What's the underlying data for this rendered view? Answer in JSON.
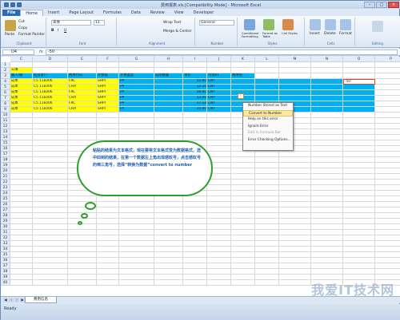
{
  "window": {
    "title": "费用报表.xls [Compatibility Mode] - Microsoft Excel"
  },
  "ribbon_tabs": [
    "File",
    "Home",
    "Insert",
    "Page Layout",
    "Formulas",
    "Data",
    "Review",
    "View",
    "Developer"
  ],
  "ribbon": {
    "clipboard": {
      "cut": "Cut",
      "copy": "Copy",
      "format_painter": "Format Painter",
      "paste": "Paste",
      "label": "Clipboard"
    },
    "font": {
      "name": "宋体",
      "size": "11",
      "label": "Font"
    },
    "alignment": {
      "wrap": "Wrap Text",
      "merge": "Merge & Center",
      "label": "Alignment"
    },
    "number": {
      "format": "General",
      "label": "Number"
    },
    "styles": {
      "conditional": "Conditional Formatting",
      "format_table": "Format as Table",
      "cell_styles": "Cell Styles",
      "label": "Styles"
    },
    "cells": {
      "insert": "Insert",
      "delete": "Delete",
      "format": "Format",
      "label": "Cells"
    },
    "editing": {
      "label": "Editing"
    }
  },
  "formula_bar": {
    "name_box": "O4",
    "fx": "fx",
    "value": "-50"
  },
  "columns": [
    "C",
    "D",
    "E",
    "F",
    "G",
    "H",
    "I",
    "J",
    "K",
    "L",
    "M",
    "N",
    "O",
    "P"
  ],
  "rows": [
    "1",
    "2",
    "3",
    "4",
    "5",
    "6",
    "7",
    "8",
    "9",
    "10",
    "11",
    "12",
    "13",
    "14",
    "15",
    "16",
    "17",
    "18",
    "19",
    "20",
    "21",
    "22",
    "23",
    "24",
    "25",
    "26",
    "27",
    "28",
    "29",
    "30",
    "31",
    "32",
    "33",
    "34",
    "35",
    "36",
    "37",
    "38",
    "39",
    "40"
  ],
  "sheet": {
    "title_cell": "公填",
    "headers": [
      "输入/输",
      "提货客户",
      "费用代码",
      "计费规",
      "计费类型",
      "实际数量",
      "单价",
      "币别01",
      "费用组"
    ],
    "data_rows": [
      [
        "成本",
        "C5 11E006",
        "FRC",
        "SHPT",
        "PP",
        "",
        "55.00",
        "CNY",
        ""
      ],
      [
        "成本",
        "C5 11E006",
        "CHA",
        "SHPT",
        "PP",
        "",
        "12.35",
        "CNY",
        ""
      ],
      [
        "成本",
        "C5 11E006",
        "FRC",
        "SHPT",
        "PP",
        "",
        "58.00",
        "CNY",
        ""
      ],
      [
        "成本",
        "C5 11E006",
        "CHA",
        "SHPT",
        "PP",
        "",
        "13.00",
        "CNY",
        ""
      ],
      [
        "成本",
        "C5 11E006",
        "FRC",
        "SHPT",
        "PP",
        "",
        "27.14",
        "CNY",
        ""
      ],
      [
        "成本",
        "C5 11E006",
        "CHA",
        "SHPT",
        "PP",
        "",
        "35.00",
        "CNY",
        ""
      ]
    ],
    "selected_value": "-50"
  },
  "context_menu": {
    "items": [
      {
        "label": "Number Stored as Text",
        "disabled": false,
        "highlight": false
      },
      {
        "label": "Convert to Number",
        "disabled": false,
        "highlight": true
      },
      {
        "label": "Help on this error",
        "disabled": false,
        "highlight": false
      },
      {
        "label": "Ignore Error",
        "disabled": false,
        "highlight": false
      },
      {
        "label": "Edit in Formula Bar",
        "disabled": true,
        "highlight": false
      },
      {
        "label": "Error Checking Options...",
        "disabled": false,
        "highlight": false
      }
    ]
  },
  "callout": {
    "text": "粘贴的结果为文本格式，现在要将文本格式变为数据格式，选中四到的结果，在第一个数据左上角出现感叹号，点击感叹号的倒三角号，选择“转换为数据”convert to number",
    "border_color": "#2e9e2e",
    "text_color": "#1e5fb0"
  },
  "sheet_tab": "费用信息",
  "status": "Ready",
  "watermark": "我爱IT技术网",
  "colors": {
    "header_blue": "#00b0f0",
    "yellow": "#ffff00"
  }
}
